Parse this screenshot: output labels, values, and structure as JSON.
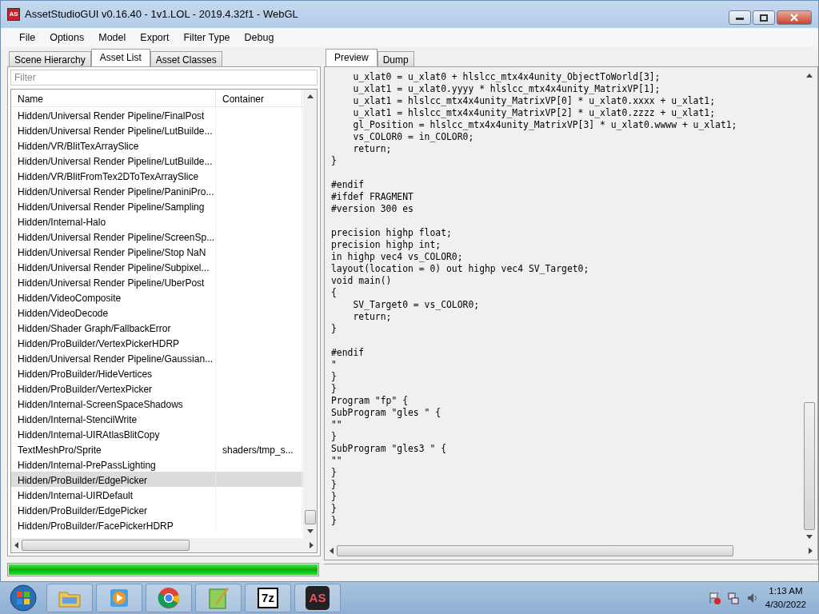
{
  "window": {
    "title": "AssetStudioGUI v0.16.40 - 1v1.LOL - 2019.4.32f1 - WebGL",
    "logo": "AS"
  },
  "menu": [
    "File",
    "Options",
    "Model",
    "Export",
    "Filter Type",
    "Debug"
  ],
  "left_tabs": [
    {
      "label": "Scene Hierarchy",
      "selected": false
    },
    {
      "label": "Asset List",
      "selected": true
    },
    {
      "label": "Asset Classes",
      "selected": false
    }
  ],
  "filter": {
    "placeholder": "Filter"
  },
  "table": {
    "columns": [
      "Name",
      "Container"
    ],
    "rows": [
      {
        "name": "Hidden/Universal Render Pipeline/FinalPost",
        "container": "",
        "selected": false
      },
      {
        "name": "Hidden/Universal Render Pipeline/LutBuilde...",
        "container": "",
        "selected": false
      },
      {
        "name": "Hidden/VR/BlitTexArraySlice",
        "container": "",
        "selected": false
      },
      {
        "name": "Hidden/Universal Render Pipeline/LutBuilde...",
        "container": "",
        "selected": false
      },
      {
        "name": "Hidden/VR/BlitFromTex2DToTexArraySlice",
        "container": "",
        "selected": false
      },
      {
        "name": "Hidden/Universal Render Pipeline/PaniniPro...",
        "container": "",
        "selected": false
      },
      {
        "name": "Hidden/Universal Render Pipeline/Sampling",
        "container": "",
        "selected": false
      },
      {
        "name": "Hidden/Internal-Halo",
        "container": "",
        "selected": false
      },
      {
        "name": "Hidden/Universal Render Pipeline/ScreenSp...",
        "container": "",
        "selected": false
      },
      {
        "name": "Hidden/Universal Render Pipeline/Stop NaN",
        "container": "",
        "selected": false
      },
      {
        "name": "Hidden/Universal Render Pipeline/Subpixel...",
        "container": "",
        "selected": false
      },
      {
        "name": "Hidden/Universal Render Pipeline/UberPost",
        "container": "",
        "selected": false
      },
      {
        "name": "Hidden/VideoComposite",
        "container": "",
        "selected": false
      },
      {
        "name": "Hidden/VideoDecode",
        "container": "",
        "selected": false
      },
      {
        "name": "Hidden/Shader Graph/FallbackError",
        "container": "",
        "selected": false
      },
      {
        "name": "Hidden/ProBuilder/VertexPickerHDRP",
        "container": "",
        "selected": false
      },
      {
        "name": "Hidden/Universal Render Pipeline/Gaussian...",
        "container": "",
        "selected": false
      },
      {
        "name": "Hidden/ProBuilder/HideVertices",
        "container": "",
        "selected": false
      },
      {
        "name": "Hidden/ProBuilder/VertexPicker",
        "container": "",
        "selected": false
      },
      {
        "name": "Hidden/Internal-ScreenSpaceShadows",
        "container": "",
        "selected": false
      },
      {
        "name": "Hidden/Internal-StencilWrite",
        "container": "",
        "selected": false
      },
      {
        "name": "Hidden/Internal-UIRAtlasBlitCopy",
        "container": "",
        "selected": false
      },
      {
        "name": "TextMeshPro/Sprite",
        "container": "shaders/tmp_s...",
        "selected": false
      },
      {
        "name": "Hidden/Internal-PrePassLighting",
        "container": "",
        "selected": false
      },
      {
        "name": "Hidden/ProBuilder/EdgePicker",
        "container": "",
        "selected": true
      },
      {
        "name": "Hidden/Internal-UIRDefault",
        "container": "",
        "selected": false
      },
      {
        "name": "Hidden/ProBuilder/EdgePicker",
        "container": "",
        "selected": false
      },
      {
        "name": "Hidden/ProBuilder/FacePickerHDRP",
        "container": "",
        "selected": false
      }
    ]
  },
  "progress": {
    "level": 1
  },
  "right_tabs": [
    {
      "label": "Preview",
      "selected": true
    },
    {
      "label": "Dump",
      "selected": false
    }
  ],
  "code_blocks": [
    [
      "    u_xlat0 = u_xlat0 + hlslcc_mtx4x4unity_ObjectToWorld[3];",
      "    u_xlat1 = u_xlat0.yyyy * hlslcc_mtx4x4unity_MatrixVP[1];",
      "    u_xlat1 = hlslcc_mtx4x4unity_MatrixVP[0] * u_xlat0.xxxx + u_xlat1;",
      "    u_xlat1 = hlslcc_mtx4x4unity_MatrixVP[2] * u_xlat0.zzzz + u_xlat1;",
      "    gl_Position = hlslcc_mtx4x4unity_MatrixVP[3] * u_xlat0.wwww + u_xlat1;",
      "    vs_COLOR0 = in_COLOR0;",
      "    return;",
      "}"
    ],
    [
      "#endif",
      "#ifdef FRAGMENT",
      "#version 300 es"
    ],
    [
      "precision highp float;",
      "precision highp int;",
      "in highp vec4 vs_COLOR0;",
      "layout(location = 0) out highp vec4 SV_Target0;",
      "void main()",
      "{",
      "    SV_Target0 = vs_COLOR0;",
      "    return;",
      "}"
    ],
    [
      "#endif",
      "\"",
      "}",
      "}",
      "Program \"fp\" {",
      "SubProgram \"gles \" {",
      "\"\"",
      "}",
      "SubProgram \"gles3 \" {",
      "\"\"",
      "}",
      "}",
      "}",
      "}",
      "}"
    ]
  ],
  "taskbar": {
    "items": [
      {
        "kind": "folder"
      },
      {
        "kind": "media"
      },
      {
        "kind": "browser"
      },
      {
        "kind": "notepad"
      },
      {
        "kind": "zip",
        "label": "7z"
      },
      {
        "kind": "app",
        "label": "AS"
      }
    ],
    "time": "1:13 AM",
    "date": "4/30/2022"
  }
}
